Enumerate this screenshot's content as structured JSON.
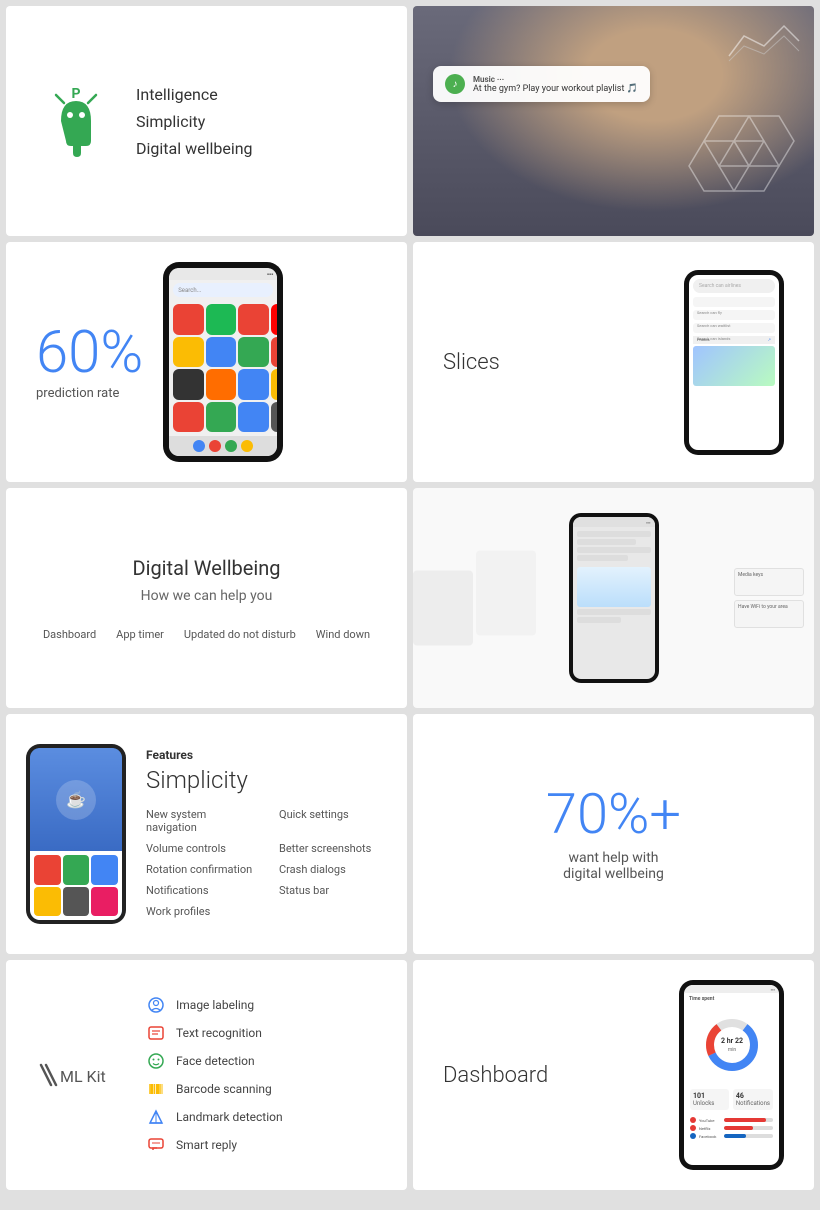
{
  "cards": {
    "android_p": {
      "features": [
        "Intelligence",
        "Simplicity",
        "Digital wellbeing"
      ]
    },
    "prediction": {
      "percent": "60%",
      "label": "prediction rate"
    },
    "slices": {
      "label": "Slices"
    },
    "wellbeing": {
      "title": "Digital Wellbeing",
      "subtitle": "How we can help you",
      "tags": [
        "Dashboard",
        "App timer",
        "Updated do not disturb",
        "Wind down"
      ]
    },
    "features": {
      "tag": "Features",
      "title": "Simplicity",
      "items_col1": [
        "New system navigation",
        "Volume controls",
        "Rotation confirmation",
        "Notifications",
        "Work profiles"
      ],
      "items_col2": [
        "Quick settings",
        "Better screenshots",
        "Crash dialogs",
        "Status bar"
      ]
    },
    "wellbeing_stat": {
      "percent": "70%+",
      "text": "want help with\ndigital wellbeing"
    },
    "mlkit": {
      "logo_text": "ML Kit",
      "features": [
        {
          "icon": "👤",
          "label": "Image labeling"
        },
        {
          "icon": "🔡",
          "label": "Text recognition"
        },
        {
          "icon": "😊",
          "label": "Face detection"
        },
        {
          "icon": "▦",
          "label": "Barcode scanning"
        },
        {
          "icon": "🏛",
          "label": "Landmark detection"
        },
        {
          "icon": "💬",
          "label": "Smart reply"
        }
      ]
    },
    "dashboard": {
      "label": "Dashboard",
      "apps": [
        {
          "name": "YouTube",
          "color": "#e53935",
          "pct": 85
        },
        {
          "name": "Netflix",
          "color": "#e53935",
          "pct": 60
        },
        {
          "name": "Facebook",
          "color": "#1565c0",
          "pct": 45
        }
      ]
    }
  },
  "colors": {
    "blue": "#4285f4",
    "green": "#34a853",
    "red": "#ea4335",
    "yellow": "#fbbc04"
  }
}
